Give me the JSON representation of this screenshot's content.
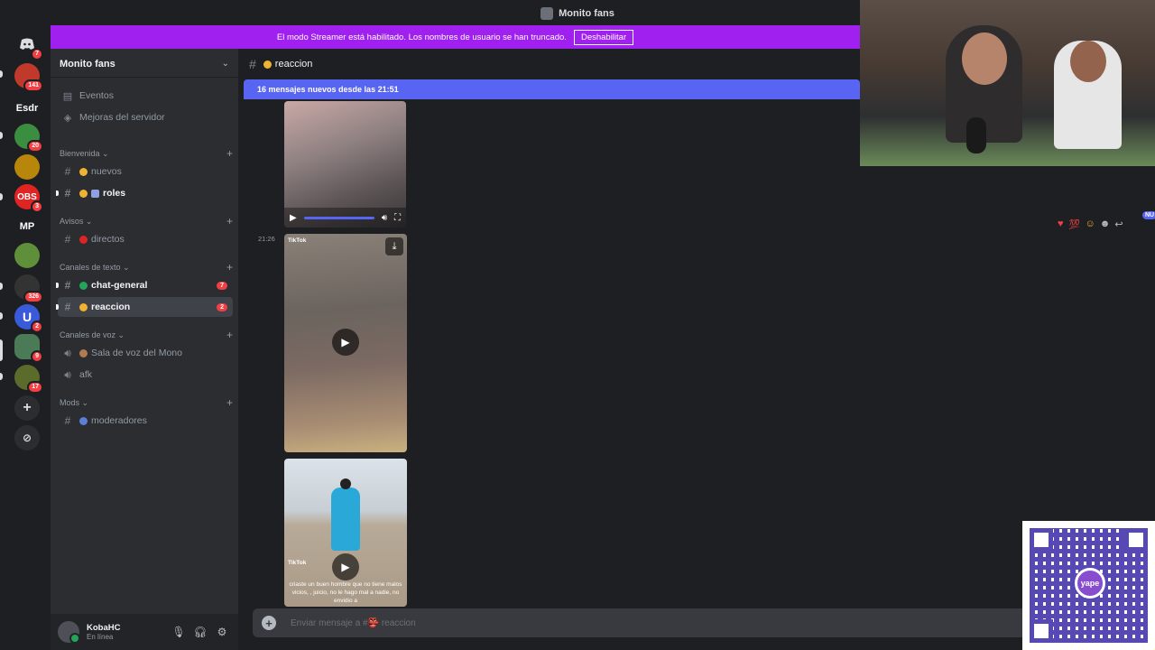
{
  "window": {
    "title": "Monito fans"
  },
  "streamer_banner": {
    "text": "El modo Streamer está habilitado. Los nombres de usuario se han truncado.",
    "button": "Deshabilitar"
  },
  "server_rail": {
    "items": [
      {
        "label": "",
        "badge": "7",
        "icon": "discord-icon",
        "color": "#1e1f22"
      },
      {
        "label": "",
        "badge": "141",
        "color": "#c0392b"
      },
      {
        "label": "Esdr",
        "badge": ""
      },
      {
        "label": "",
        "badge": "20",
        "color": "#3b8d3f"
      },
      {
        "label": "",
        "badge": "",
        "color": "#b8860b"
      },
      {
        "label": "OBS",
        "badge": "3",
        "color": "#e02424"
      },
      {
        "label": "MP",
        "badge": ""
      },
      {
        "label": "",
        "badge": "",
        "color": "#5f8f3a"
      },
      {
        "label": "",
        "badge": "326",
        "color": "#333333"
      },
      {
        "label": "U",
        "badge": "2",
        "color": "#3a5bd9"
      },
      {
        "label": "",
        "badge": "9",
        "color": "#4a7a56"
      },
      {
        "label": "",
        "badge": "17",
        "color": "#5a6b2c"
      }
    ]
  },
  "sidebar": {
    "server_name": "Monito fans",
    "top_items": [
      {
        "label": "Eventos",
        "icon": "calendar-icon"
      },
      {
        "label": "Mejoras del servidor",
        "icon": "boost-icon"
      }
    ],
    "categories": [
      {
        "name": "Bienvenida"
      },
      {
        "name": "Avisos"
      },
      {
        "name": "Canales de texto"
      },
      {
        "name": "Canales de voz"
      },
      {
        "name": "Mods"
      }
    ],
    "channels": {
      "nuevos": {
        "label": "nuevos"
      },
      "roles": {
        "label": "roles"
      },
      "directos": {
        "label": "directos"
      },
      "chat_general": {
        "label": "chat-general",
        "count": "7"
      },
      "reaccion": {
        "label": "reaccion",
        "count": "2"
      },
      "sala_voz": {
        "label": "Sala de voz del Mono"
      },
      "afk": {
        "label": "afk"
      },
      "moderadores": {
        "label": "moderadores"
      }
    }
  },
  "user": {
    "name": "KobaHC",
    "status": "En línea"
  },
  "main": {
    "channel_name": "reaccion",
    "new_messages_bar": "16 mensajes nuevos desde las 21:51",
    "timestamp": "21:26",
    "tiktok_label": "TikTok",
    "video3_caption": "criaste un buen hombre que no tiene malos vicios, , juicio, no le hago mal a nadie, no envidio a",
    "composer_placeholder": "Enviar mensaje a #👺 reaccion",
    "new_badge": "NU"
  },
  "qr": {
    "brand": "yape"
  },
  "colors": {
    "accent": "#5865f2",
    "streamer": "#a020f0",
    "mention": "#f23f43",
    "online": "#23a55a"
  }
}
